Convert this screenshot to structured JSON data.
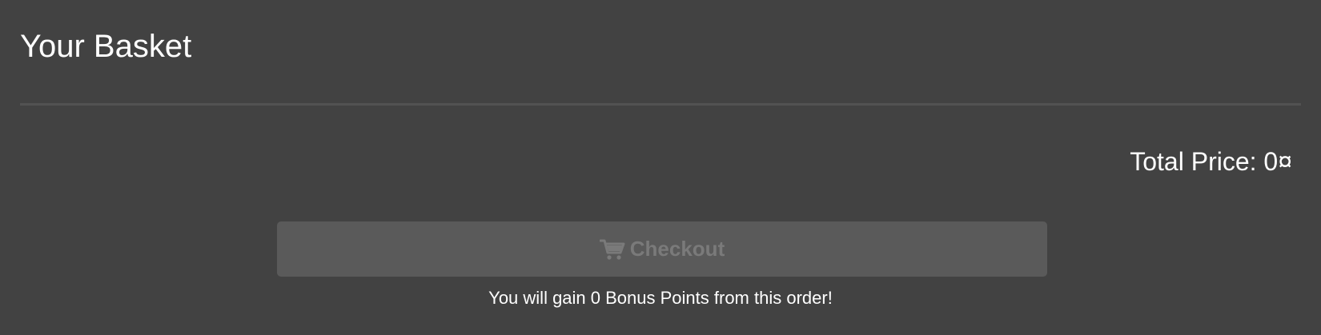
{
  "basket": {
    "title": "Your Basket",
    "total_price": "Total Price: 0¤"
  },
  "checkout": {
    "label": "Checkout",
    "icon": "shopping-cart-icon",
    "disabled": true,
    "bonus_message": "You will gain 0 Bonus Points from this order!"
  },
  "colors": {
    "background": "#424242",
    "divider": "#525252",
    "button_disabled": "#5a5a5a",
    "button_text_disabled": "#7a7a7a",
    "text": "#ffffff"
  }
}
